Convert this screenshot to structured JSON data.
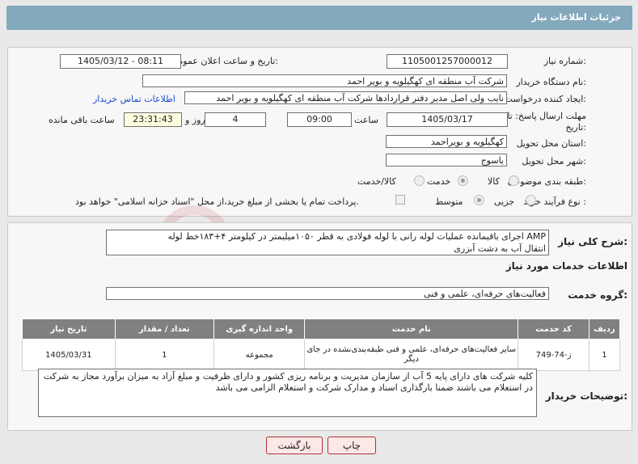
{
  "header": {
    "title": "جزئیات اطلاعات نیاز"
  },
  "form": {
    "need_number_label": "شماره نیاز:",
    "need_number": "1105001257000012",
    "announce_label": "تاریخ و ساعت اعلان عمومی:",
    "announce_value": "1405/03/12 - 08:11",
    "buyer_label": "نام دستگاه خریدار:",
    "buyer_value": "شرکت آب منطقه ای کهگیلویه و بویر احمد",
    "creator_label": "ایجاد کننده درخواست:",
    "creator_value": "نایب ولی اصل مدیر دفتر قراردادها شرکت آب منطقه ای کهگیلویه و بویر احمد",
    "contact_link": "اطلاعات تماس خریدار",
    "deadline_label": "مهلت ارسال پاسخ: تا تاریخ:",
    "deadline_date": "1405/03/17",
    "time_label": "ساعت",
    "deadline_time": "09:00",
    "days_value": "4",
    "days_label": "روز و",
    "remaining_time": "23:31:43",
    "remaining_label": "ساعت باقی مانده",
    "province_label": "استان محل تحویل:",
    "province_value": "کهگیلویه و بویراحمد",
    "city_label": "شهر محل تحویل:",
    "city_value": "یاسوج",
    "category_label": "طبقه بندی موضوعی:",
    "category_options": [
      "کالا",
      "خدمت",
      "کالا/خدمت"
    ],
    "category_selected": "خدمت",
    "process_label": "نوع فرآیند خرید :",
    "process_options": [
      "جزیی",
      "متوسط"
    ],
    "process_selected": "متوسط",
    "payment_note": "پرداخت تمام یا بخشی از مبلغ خرید،از محل \"اسناد خزانه اسلامی\" خواهد بود."
  },
  "description": {
    "label": "شرح کلی نیاز:",
    "line1": "AMP اجرای باقیمانده عملیات لوله رانی با لوله فولادی به قطر ۱۰۵۰میلیمتر در کیلومتر ۴+۱۸۳خط لوله",
    "line2": "انتقال آب به دشت آبزری"
  },
  "services": {
    "section_title": "اطلاعات خدمات مورد نیاز",
    "group_label": "گروه خدمت:",
    "group_value": "فعالیت‌های حرفه‌ای، علمی و فنی"
  },
  "table": {
    "headers": [
      "ردیف",
      "کد خدمت",
      "نام خدمت",
      "واحد اندازه گیری",
      "تعداد / مقدار",
      "تاریخ نیاز"
    ],
    "rows": [
      {
        "row": "1",
        "code": "ز-74-749",
        "name": "سایر فعالیت‌های حرفه‌ای، علمی و فنی طبقه‌بندی‌نشده در جای دیگر",
        "unit": "مجموعه",
        "qty": "1",
        "date": "1405/03/31"
      }
    ]
  },
  "buyer_notes": {
    "label": "توضیحات خریدار:",
    "text": "کلیه شرکت های دارای پایه 5 آب از سازمان مدیریت و برنامه ریزی کشور و دارای ظرفیت و مبلغ آزاد به میزان برآورد مجاز به شرکت در استعلام می باشند ضمنا بارگذاری اسناد و مدارک شرکت و استعلام الزامی می باشد"
  },
  "buttons": {
    "print": "چاپ",
    "back": "بازگشت"
  },
  "watermark": {
    "text": "AriaTender.net"
  },
  "colors": {
    "header": "#84a9bd",
    "table_header": "#808080",
    "link": "#1a4fd0",
    "button_border": "#b03030"
  }
}
